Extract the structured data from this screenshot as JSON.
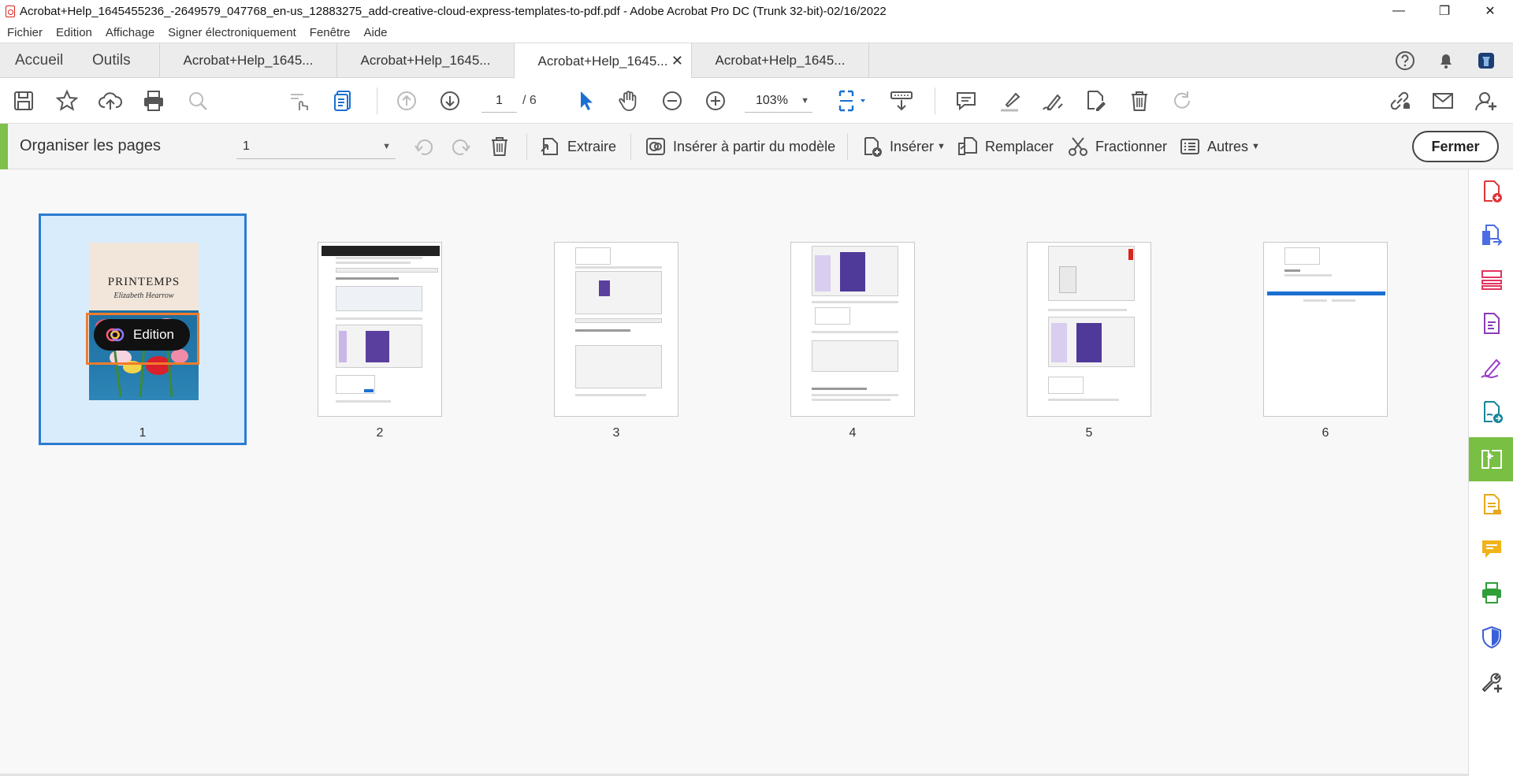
{
  "window": {
    "title": "Acrobat+Help_1645455236_-2649579_047768_en-us_12883275_add-creative-cloud-express-templates-to-pdf.pdf - Adobe Acrobat Pro DC (Trunk 32-bit)-02/16/2022",
    "controls": {
      "minimize": "—",
      "restore": "❐",
      "close": "✕"
    }
  },
  "menu": [
    "Fichier",
    "Edition",
    "Affichage",
    "Signer électroniquement",
    "Fenêtre",
    "Aide"
  ],
  "nav_tabs": {
    "home": "Accueil",
    "tools": "Outils"
  },
  "doc_tabs": [
    {
      "label": "Acrobat+Help_1645...",
      "active": false
    },
    {
      "label": "Acrobat+Help_1645...",
      "active": false
    },
    {
      "label": "Acrobat+Help_1645...",
      "active": true,
      "close": "✕"
    },
    {
      "label": "Acrobat+Help_1645...",
      "active": false
    }
  ],
  "toolbar": {
    "current_page": "1",
    "total_pages": "/ 6",
    "zoom": "103%"
  },
  "organize": {
    "title": "Organiser les pages",
    "page_select": "1",
    "extract": "Extraire",
    "insert_template": "Insérer à partir du modèle",
    "insert": "Insérer",
    "replace": "Remplacer",
    "split": "Fractionner",
    "more": "Autres",
    "close": "Fermer"
  },
  "thumbnails": [
    {
      "number": "1",
      "selected": true,
      "cover_title": "PRINTEMPS",
      "cover_author": "Elizabeth Hearrow",
      "edit_label": "Edition"
    },
    {
      "number": "2",
      "selected": false
    },
    {
      "number": "3",
      "selected": false
    },
    {
      "number": "4",
      "selected": false
    },
    {
      "number": "5",
      "selected": false
    },
    {
      "number": "6",
      "selected": false
    }
  ],
  "colors": {
    "accent_green": "#78bf43",
    "selection_blue": "#2c7bd1",
    "highlight_orange": "#f07c2c",
    "acrobat_red": "#d7261d"
  },
  "right_rail_icons": [
    "create-pdf-icon",
    "combine-files-icon",
    "edit-pdf-icon",
    "export-pdf-icon",
    "fill-sign-icon",
    "send-sign-icon",
    "organize-pages-icon",
    "scan-ocr-icon",
    "comment-icon",
    "print-production-icon",
    "protect-icon",
    "more-tools-icon"
  ]
}
